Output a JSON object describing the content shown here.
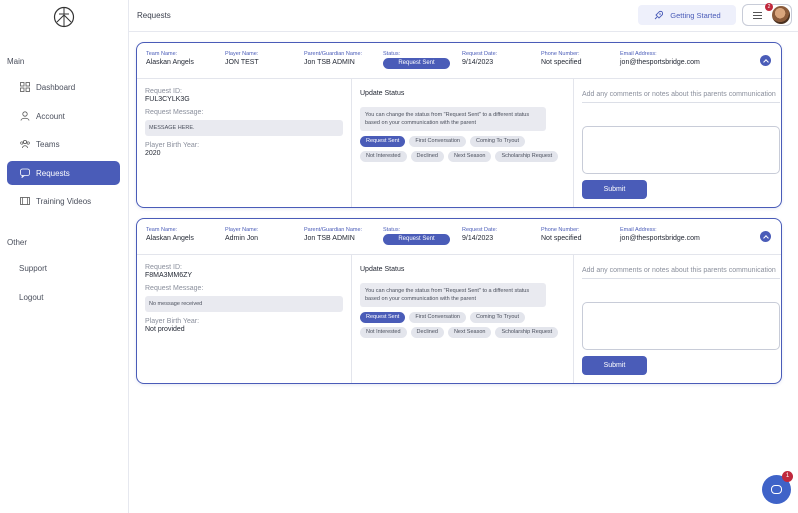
{
  "sidebar": {
    "main_label": "Main",
    "other_label": "Other",
    "items": [
      {
        "label": "Dashboard",
        "icon": "grid-icon"
      },
      {
        "label": "Account",
        "icon": "user-icon"
      },
      {
        "label": "Teams",
        "icon": "team-icon"
      },
      {
        "label": "Requests",
        "icon": "chat-icon"
      },
      {
        "label": "Training Videos",
        "icon": "film-icon"
      }
    ],
    "support": "Support",
    "logout": "Logout"
  },
  "header": {
    "title": "Requests",
    "getting_started": "Getting Started",
    "notification_count": "2"
  },
  "columns": {
    "team": "Team Name:",
    "player": "Player Name:",
    "parent": "Parent/Guardian Name:",
    "status": "Status:",
    "date": "Request Date:",
    "phone": "Phone Number:",
    "email": "Email Address:"
  },
  "labels": {
    "request_id": "Request ID:",
    "request_message": "Request Message:",
    "birth_year": "Player Birth Year:",
    "update_status": "Update Status",
    "hint": "You can change the status from \"Request Sent\" to a different status based on your communication with the parent",
    "comment_placeholder": "Add any comments or notes about this parents communication",
    "submit": "Submit"
  },
  "status_options": [
    "Request Sent",
    "First Conversation",
    "Coming To Tryout",
    "Not Interested",
    "Declined",
    "Next Season",
    "Scholarship Request"
  ],
  "requests": [
    {
      "team": "Alaskan Angels",
      "player": "JON TEST",
      "parent": "Jon TSB ADMIN",
      "status": "Request Sent",
      "date": "9/14/2023",
      "phone": "Not specified",
      "email": "jon@thesportsbridge.com",
      "request_id": "FUL3CYLK3G",
      "message": "MESSAGE HERE.",
      "birth_year": "2020"
    },
    {
      "team": "Alaskan Angels",
      "player": "Admin Jon",
      "parent": "Jon TSB ADMIN",
      "status": "Request Sent",
      "date": "9/14/2023",
      "phone": "Not specified",
      "email": "jon@thesportsbridge.com",
      "request_id": "F8MA3MM6ZY",
      "message": "No message received",
      "birth_year": "Not provided"
    }
  ],
  "chat": {
    "badge": "1"
  },
  "colors": {
    "accent": "#4a5cb8",
    "badge": "#c0283c"
  }
}
